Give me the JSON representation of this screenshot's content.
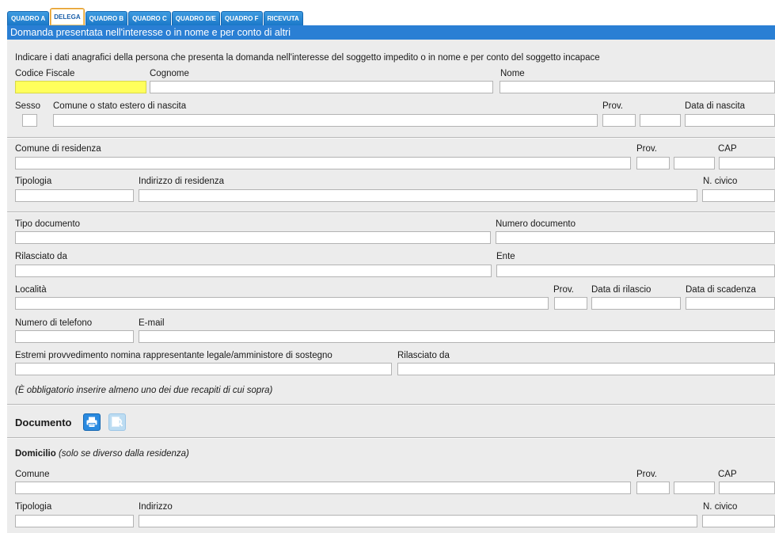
{
  "tabs": [
    {
      "label": "QUADRO A",
      "active": false
    },
    {
      "label": "DELEGA",
      "active": true
    },
    {
      "label": "QUADRO B",
      "active": false
    },
    {
      "label": "QUADRO C",
      "active": false
    },
    {
      "label": "QUADRO D/E",
      "active": false
    },
    {
      "label": "QUADRO F",
      "active": false
    },
    {
      "label": "RICEVUTA",
      "active": false
    }
  ],
  "section_title": "Domanda presentata nell'interesse o in nome e per conto di altri",
  "intro": "Indicare i dati anagrafici della persona che presenta la domanda nell'interesse del soggetto impedito o in nome e per conto del soggetto incapace",
  "labels": {
    "codice_fiscale": "Codice Fiscale",
    "cognome": "Cognome",
    "nome": "Nome",
    "sesso": "Sesso",
    "comune_nascita": "Comune o stato estero di nascita",
    "prov": "Prov.",
    "data_nascita": "Data di nascita",
    "comune_residenza": "Comune di residenza",
    "cap": "CAP",
    "tipologia": "Tipologia",
    "indirizzo_residenza": "Indirizzo di residenza",
    "n_civico": "N. civico",
    "tipo_documento": "Tipo documento",
    "numero_documento": "Numero documento",
    "rilasciato_da": "Rilasciato da",
    "ente": "Ente",
    "localita": "Località",
    "data_rilascio": "Data di rilascio",
    "data_scadenza": "Data di scadenza",
    "numero_telefono": "Numero di telefono",
    "email": "E-mail",
    "estremi": "Estremi provvedimento nomina rappresentante legale/amministore di sostegno",
    "rilasciato_da2": "Rilasciato da",
    "obbligatorio_note": "(È obbligatorio inserire almeno uno dei due recapiti di cui sopra)",
    "documento": "Documento",
    "domicilio": "Domicilio",
    "domicilio_note": "(solo se diverso dalla residenza)",
    "comune": "Comune",
    "indirizzo": "Indirizzo"
  },
  "colors": {
    "tab_blue": "#1a78c8",
    "title_bar": "#2a7fd4",
    "panel_bg": "#ececec",
    "required_field": "#ffff5c"
  },
  "icons": {
    "print": "printer-icon",
    "preview": "magnifier-preview-icon"
  }
}
